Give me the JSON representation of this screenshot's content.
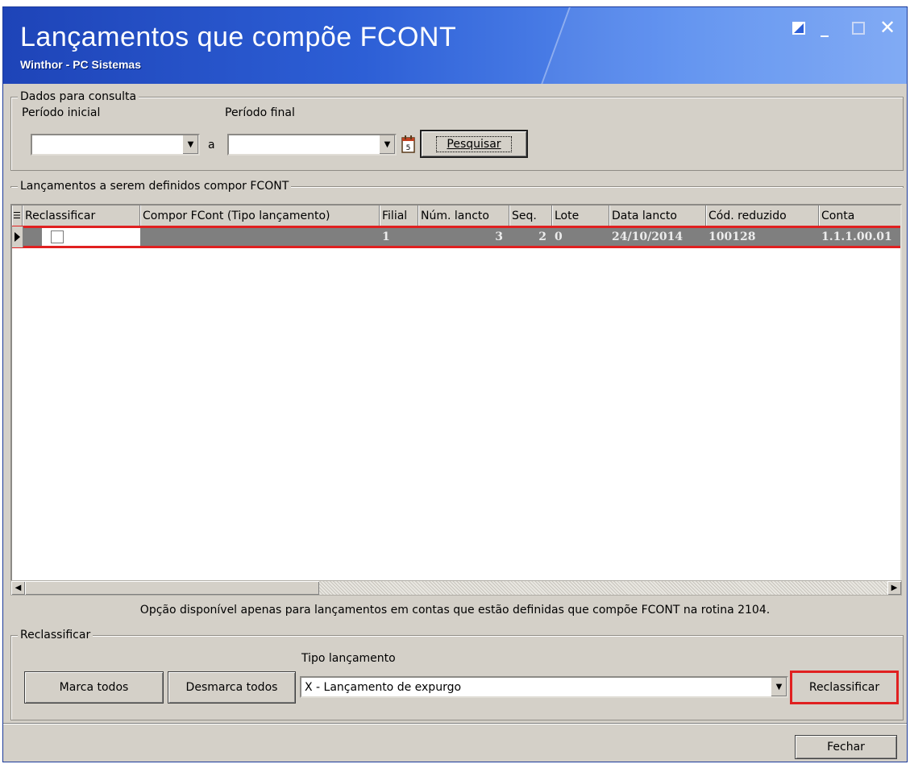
{
  "window": {
    "title": "Lançamentos que compõe FCONT",
    "subtitle": "Winthor - PC Sistemas"
  },
  "consulta": {
    "group_title": "Dados para consulta",
    "periodo_inicial_label": "Período inicial",
    "periodo_final_label": "Período final",
    "periodo_inicial_value": "",
    "periodo_final_value": "",
    "connector": "a",
    "pesquisar_button": "Pesquisar"
  },
  "lancamentos": {
    "group_title": "Lançamentos a serem definidos compor FCONT",
    "columns": [
      "Reclassificar",
      "Compor FCont (Tipo lançamento)",
      "Filial",
      "Núm. lancto",
      "Seq.",
      "Lote",
      "Data lancto",
      "Cód. reduzido",
      "Conta"
    ],
    "rows": [
      {
        "reclassificar": false,
        "compor": "",
        "filial": "1",
        "num_lancto": "3",
        "seq": "2",
        "lote": "0",
        "data_lancto": "24/10/2014",
        "cod_reduzido": "100128",
        "conta": "1.1.1.00.01"
      }
    ]
  },
  "info_text": "Opção disponível apenas para lançamentos em contas que estão definidas que compõe FCONT na rotina 2104.",
  "reclassificar": {
    "group_title": "Reclassificar",
    "tipo_label": "Tipo lançamento",
    "tipo_value": "X - Lançamento de expurgo",
    "marca_todos": "Marca todos",
    "desmarca_todos": "Desmarca todos",
    "reclassificar_button": "Reclassificar"
  },
  "footer": {
    "fechar_button": "Fechar"
  },
  "colors": {
    "title_bar": "#2d5fd6",
    "selected_row": "#7f7f7f",
    "highlight": "#e02020"
  }
}
